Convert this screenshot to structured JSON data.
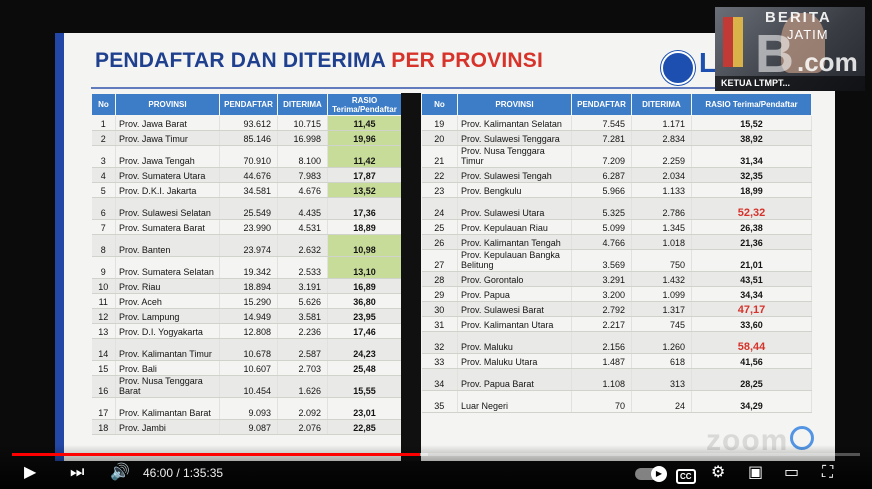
{
  "slide": {
    "title_main": "PENDAFTAR DAN DITERIMA ",
    "title_accent": "PER PROVINSI",
    "logo_text": "L",
    "headers": [
      "No",
      "PROVINSI",
      "PENDAFTAR",
      "DITERIMA",
      "RASIO Terima/Pendaftar"
    ],
    "left_rows": [
      {
        "no": "1",
        "prov": "Prov. Jawa Barat",
        "pendaftar": "93.612",
        "diterima": "10.715",
        "rasio": "11,45",
        "hl": "green"
      },
      {
        "no": "2",
        "prov": "Prov. Jawa Timur",
        "pendaftar": "85.146",
        "diterima": "16.998",
        "rasio": "19,96",
        "hl": "green"
      },
      {
        "no": "3",
        "prov": "Prov. Jawa Tengah",
        "pendaftar": "70.910",
        "diterima": "8.100",
        "rasio": "11,42",
        "hl": "green"
      },
      {
        "no": "4",
        "prov": "Prov. Sumatera Utara",
        "pendaftar": "44.676",
        "diterima": "7.983",
        "rasio": "17,87",
        "hl": ""
      },
      {
        "no": "5",
        "prov": "Prov. D.K.I. Jakarta",
        "pendaftar": "34.581",
        "diterima": "4.676",
        "rasio": "13,52",
        "hl": "green"
      },
      {
        "no": "6",
        "prov": "Prov. Sulawesi Selatan",
        "pendaftar": "25.549",
        "diterima": "4.435",
        "rasio": "17,36",
        "hl": ""
      },
      {
        "no": "7",
        "prov": "Prov. Sumatera Barat",
        "pendaftar": "23.990",
        "diterima": "4.531",
        "rasio": "18,89",
        "hl": ""
      },
      {
        "no": "8",
        "prov": "Prov. Banten",
        "pendaftar": "23.974",
        "diterima": "2.632",
        "rasio": "10,98",
        "hl": "green"
      },
      {
        "no": "9",
        "prov": "Prov. Sumatera Selatan",
        "pendaftar": "19.342",
        "diterima": "2.533",
        "rasio": "13,10",
        "hl": "green"
      },
      {
        "no": "10",
        "prov": "Prov. Riau",
        "pendaftar": "18.894",
        "diterima": "3.191",
        "rasio": "16,89",
        "hl": ""
      },
      {
        "no": "11",
        "prov": "Prov. Aceh",
        "pendaftar": "15.290",
        "diterima": "5.626",
        "rasio": "36,80",
        "hl": ""
      },
      {
        "no": "12",
        "prov": "Prov. Lampung",
        "pendaftar": "14.949",
        "diterima": "3.581",
        "rasio": "23,95",
        "hl": ""
      },
      {
        "no": "13",
        "prov": "Prov. D.I. Yogyakarta",
        "pendaftar": "12.808",
        "diterima": "2.236",
        "rasio": "17,46",
        "hl": ""
      },
      {
        "no": "14",
        "prov": "Prov. Kalimantan Timur",
        "pendaftar": "10.678",
        "diterima": "2.587",
        "rasio": "24,23",
        "hl": ""
      },
      {
        "no": "15",
        "prov": "Prov. Bali",
        "pendaftar": "10.607",
        "diterima": "2.703",
        "rasio": "25,48",
        "hl": ""
      },
      {
        "no": "16",
        "prov": "Prov. Nusa Tenggara Barat",
        "pendaftar": "10.454",
        "diterima": "1.626",
        "rasio": "15,55",
        "hl": ""
      },
      {
        "no": "17",
        "prov": "Prov. Kalimantan Barat",
        "pendaftar": "9.093",
        "diterima": "2.092",
        "rasio": "23,01",
        "hl": ""
      },
      {
        "no": "18",
        "prov": "Prov. Jambi",
        "pendaftar": "9.087",
        "diterima": "2.076",
        "rasio": "22,85",
        "hl": ""
      }
    ],
    "right_rows": [
      {
        "no": "19",
        "prov": "Prov. Kalimantan Selatan",
        "pendaftar": "7.545",
        "diterima": "1.171",
        "rasio": "15,52",
        "hl": ""
      },
      {
        "no": "20",
        "prov": "Prov. Sulawesi Tenggara",
        "pendaftar": "7.281",
        "diterima": "2.834",
        "rasio": "38,92",
        "hl": ""
      },
      {
        "no": "21",
        "prov": "Prov. Nusa Tenggara Timur",
        "pendaftar": "7.209",
        "diterima": "2.259",
        "rasio": "31,34",
        "hl": ""
      },
      {
        "no": "22",
        "prov": "Prov. Sulawesi Tengah",
        "pendaftar": "6.287",
        "diterima": "2.034",
        "rasio": "32,35",
        "hl": ""
      },
      {
        "no": "23",
        "prov": "Prov. Bengkulu",
        "pendaftar": "5.966",
        "diterima": "1.133",
        "rasio": "18,99",
        "hl": ""
      },
      {
        "no": "24",
        "prov": "Prov. Sulawesi Utara",
        "pendaftar": "5.325",
        "diterima": "2.786",
        "rasio": "52,32",
        "hl": "red"
      },
      {
        "no": "25",
        "prov": "Prov. Kepulauan Riau",
        "pendaftar": "5.099",
        "diterima": "1.345",
        "rasio": "26,38",
        "hl": ""
      },
      {
        "no": "26",
        "prov": "Prov. Kalimantan Tengah",
        "pendaftar": "4.766",
        "diterima": "1.018",
        "rasio": "21,36",
        "hl": ""
      },
      {
        "no": "27",
        "prov": "Prov. Kepulauan Bangka Belitung",
        "pendaftar": "3.569",
        "diterima": "750",
        "rasio": "21,01",
        "hl": ""
      },
      {
        "no": "28",
        "prov": "Prov. Gorontalo",
        "pendaftar": "3.291",
        "diterima": "1.432",
        "rasio": "43,51",
        "hl": ""
      },
      {
        "no": "29",
        "prov": "Prov. Papua",
        "pendaftar": "3.200",
        "diterima": "1.099",
        "rasio": "34,34",
        "hl": ""
      },
      {
        "no": "30",
        "prov": "Prov. Sulawesi Barat",
        "pendaftar": "2.792",
        "diterima": "1.317",
        "rasio": "47,17",
        "hl": "red"
      },
      {
        "no": "31",
        "prov": "Prov. Kalimantan Utara",
        "pendaftar": "2.217",
        "diterima": "745",
        "rasio": "33,60",
        "hl": ""
      },
      {
        "no": "32",
        "prov": "Prov. Maluku",
        "pendaftar": "2.156",
        "diterima": "1.260",
        "rasio": "58,44",
        "hl": "red"
      },
      {
        "no": "33",
        "prov": "Prov. Maluku Utara",
        "pendaftar": "1.487",
        "diterima": "618",
        "rasio": "41,56",
        "hl": ""
      },
      {
        "no": "34",
        "prov": "Prov. Papua Barat",
        "pendaftar": "1.108",
        "diterima": "313",
        "rasio": "28,25",
        "hl": ""
      },
      {
        "no": "35",
        "prov": "Luar Negeri",
        "pendaftar": "70",
        "diterima": "24",
        "rasio": "34,29",
        "hl": ""
      }
    ]
  },
  "webcam": {
    "watermark_top": "BERITA",
    "watermark_mid": "JATIM",
    "watermark_com": ".com",
    "caption": "KETUA LTMPT..."
  },
  "zoom_watermark": "zoom",
  "player": {
    "current_time": "46:00",
    "duration": "1:35:35",
    "progress": 0.4812,
    "buffered": 0.49,
    "cc_label": "CC",
    "colors": {
      "progress": "#ff0000",
      "header": "#3d7cc7",
      "title": "#1f3f8f",
      "accent": "#d7332a"
    }
  }
}
